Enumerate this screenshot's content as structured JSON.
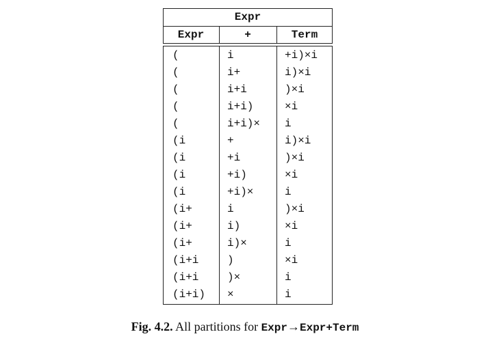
{
  "table": {
    "header": "Expr",
    "columns": [
      "Expr",
      "+",
      "Term"
    ],
    "rows": [
      [
        "(",
        "i",
        "+i)×i"
      ],
      [
        "(",
        "i+",
        "i)×i"
      ],
      [
        "(",
        "i+i",
        ")×i"
      ],
      [
        "(",
        "i+i)",
        "×i"
      ],
      [
        "(",
        "i+i)×",
        "i"
      ],
      [
        "(i",
        "+",
        "i)×i"
      ],
      [
        "(i",
        "+i",
        ")×i"
      ],
      [
        "(i",
        "+i)",
        "×i"
      ],
      [
        "(i",
        "+i)×",
        "i"
      ],
      [
        "(i+",
        "i",
        ")×i"
      ],
      [
        "(i+",
        "i)",
        "×i"
      ],
      [
        "(i+",
        "i)×",
        "i"
      ],
      [
        "(i+i",
        ")",
        "×i"
      ],
      [
        "(i+i",
        ")×",
        "i"
      ],
      [
        "(i+i)",
        "×",
        "i"
      ]
    ]
  },
  "caption": {
    "label": "Fig. 4.2.",
    "text": "All partitions for",
    "rule_lhs": "Expr",
    "arrow": "→",
    "rule_rhs": "Expr+Term"
  }
}
